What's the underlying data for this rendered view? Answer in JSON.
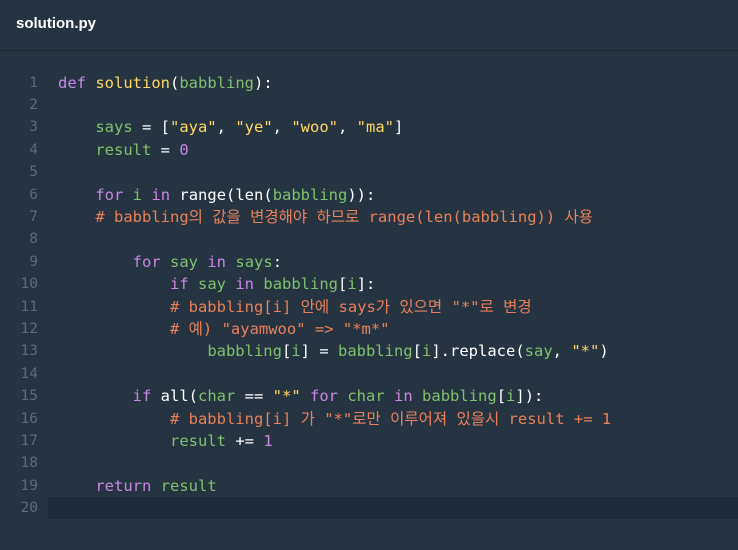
{
  "tab": {
    "filename": "solution.py"
  },
  "lines": [
    {
      "n": "1",
      "indent": 0,
      "tokens": [
        [
          "kw",
          "def"
        ],
        [
          "pl",
          " "
        ],
        [
          "fn",
          "solution"
        ],
        [
          "pl",
          "("
        ],
        [
          "nm",
          "babbling"
        ],
        [
          "pl",
          "):"
        ]
      ]
    },
    {
      "n": "2",
      "indent": 0,
      "tokens": []
    },
    {
      "n": "3",
      "indent": 4,
      "tokens": [
        [
          "nm",
          "says"
        ],
        [
          "pl",
          " = ["
        ],
        [
          "str",
          "\"aya\""
        ],
        [
          "pl",
          ", "
        ],
        [
          "str",
          "\"ye\""
        ],
        [
          "pl",
          ", "
        ],
        [
          "str",
          "\"woo\""
        ],
        [
          "pl",
          ", "
        ],
        [
          "str",
          "\"ma\""
        ],
        [
          "pl",
          "]"
        ]
      ]
    },
    {
      "n": "4",
      "indent": 4,
      "tokens": [
        [
          "nm",
          "result"
        ],
        [
          "pl",
          " = "
        ],
        [
          "num",
          "0"
        ]
      ]
    },
    {
      "n": "5",
      "indent": 0,
      "tokens": []
    },
    {
      "n": "6",
      "indent": 4,
      "tokens": [
        [
          "kw",
          "for"
        ],
        [
          "pl",
          " "
        ],
        [
          "nm",
          "i"
        ],
        [
          "pl",
          " "
        ],
        [
          "kw",
          "in"
        ],
        [
          "pl",
          " range(len("
        ],
        [
          "nm",
          "babbling"
        ],
        [
          "pl",
          "))"
        ],
        [
          "pl",
          ":"
        ]
      ]
    },
    {
      "n": "7",
      "indent": 4,
      "tokens": [
        [
          "cm",
          "# babbling의 값을 변경해야 하므로 range(len(babbling)) 사용"
        ]
      ]
    },
    {
      "n": "8",
      "indent": 0,
      "tokens": []
    },
    {
      "n": "9",
      "indent": 8,
      "tokens": [
        [
          "kw",
          "for"
        ],
        [
          "pl",
          " "
        ],
        [
          "nm",
          "say"
        ],
        [
          "pl",
          " "
        ],
        [
          "kw",
          "in"
        ],
        [
          "pl",
          " "
        ],
        [
          "nm",
          "says"
        ],
        [
          "pl",
          ":"
        ]
      ]
    },
    {
      "n": "10",
      "indent": 12,
      "tokens": [
        [
          "kw",
          "if"
        ],
        [
          "pl",
          " "
        ],
        [
          "nm",
          "say"
        ],
        [
          "pl",
          " "
        ],
        [
          "kw",
          "in"
        ],
        [
          "pl",
          " "
        ],
        [
          "nm",
          "babbling"
        ],
        [
          "pl",
          "["
        ],
        [
          "nm",
          "i"
        ],
        [
          "pl",
          "]:"
        ]
      ]
    },
    {
      "n": "11",
      "indent": 12,
      "tokens": [
        [
          "cm",
          "# babbling[i] 안에 says가 있으면 \"*\"로 변경"
        ]
      ]
    },
    {
      "n": "12",
      "indent": 12,
      "tokens": [
        [
          "cm",
          "# 예) \"ayamwoo\" => \"*m*\""
        ]
      ]
    },
    {
      "n": "13",
      "indent": 16,
      "tokens": [
        [
          "nm",
          "babbling"
        ],
        [
          "pl",
          "["
        ],
        [
          "nm",
          "i"
        ],
        [
          "pl",
          "] = "
        ],
        [
          "nm",
          "babbling"
        ],
        [
          "pl",
          "["
        ],
        [
          "nm",
          "i"
        ],
        [
          "pl",
          "].replace("
        ],
        [
          "nm",
          "say"
        ],
        [
          "pl",
          ", "
        ],
        [
          "str",
          "\"*\""
        ],
        [
          "pl",
          ")"
        ]
      ]
    },
    {
      "n": "14",
      "indent": 0,
      "tokens": []
    },
    {
      "n": "15",
      "indent": 8,
      "tokens": [
        [
          "kw",
          "if"
        ],
        [
          "pl",
          " all("
        ],
        [
          "nm",
          "char"
        ],
        [
          "pl",
          " == "
        ],
        [
          "str",
          "\"*\""
        ],
        [
          "pl",
          " "
        ],
        [
          "kw",
          "for"
        ],
        [
          "pl",
          " "
        ],
        [
          "nm",
          "char"
        ],
        [
          "pl",
          " "
        ],
        [
          "kw",
          "in"
        ],
        [
          "pl",
          " "
        ],
        [
          "nm",
          "babbling"
        ],
        [
          "pl",
          "["
        ],
        [
          "nm",
          "i"
        ],
        [
          "pl",
          "]):"
        ]
      ]
    },
    {
      "n": "16",
      "indent": 12,
      "tokens": [
        [
          "cm",
          "# babbling[i] 가 \"*\"로만 이루어져 있을시 result += 1"
        ]
      ]
    },
    {
      "n": "17",
      "indent": 12,
      "tokens": [
        [
          "nm",
          "result"
        ],
        [
          "pl",
          " += "
        ],
        [
          "num",
          "1"
        ]
      ]
    },
    {
      "n": "18",
      "indent": 0,
      "tokens": []
    },
    {
      "n": "19",
      "indent": 4,
      "tokens": [
        [
          "kw",
          "return"
        ],
        [
          "pl",
          " "
        ],
        [
          "nm",
          "result"
        ]
      ]
    },
    {
      "n": "20",
      "indent": 0,
      "tokens": [],
      "active": true
    }
  ]
}
